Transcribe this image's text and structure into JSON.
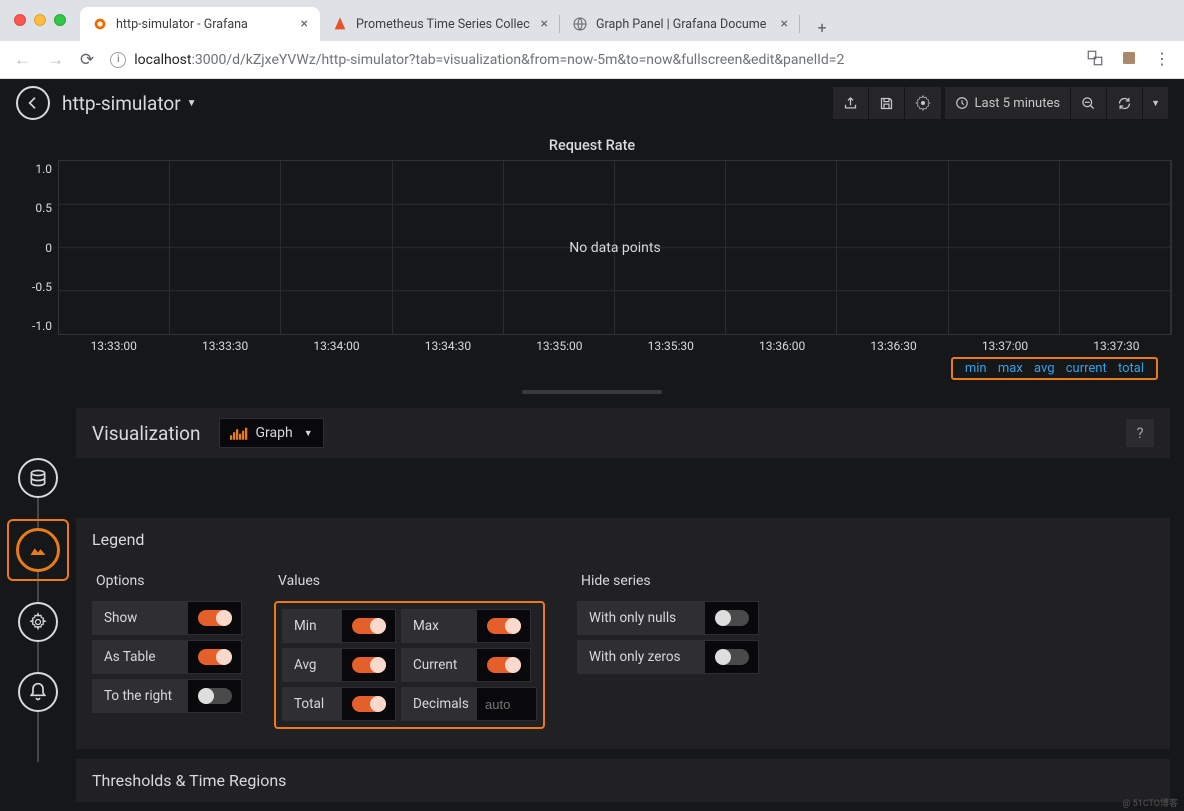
{
  "browser": {
    "tabs": [
      {
        "title": "http-simulator - Grafana",
        "active": true
      },
      {
        "title": "Prometheus Time Series Collec",
        "active": false
      },
      {
        "title": "Graph Panel | Grafana Docume",
        "active": false
      }
    ],
    "url_host": "localhost",
    "url_path": ":3000/d/kZjxeYVWz/http-simulator?tab=visualization&from=now-5m&to=now&fullscreen&edit&panelId=2"
  },
  "header": {
    "dashboard_title": "http-simulator",
    "time_range": "Last 5 minutes"
  },
  "chart_data": {
    "type": "line",
    "title": "Request Rate",
    "no_data_message": "No data points",
    "xlabel": "",
    "ylabel": "",
    "ylim": [
      -1.0,
      1.0
    ],
    "y_ticks": [
      "1.0",
      "0.5",
      "0",
      "-0.5",
      "-1.0"
    ],
    "x_ticks": [
      "13:33:00",
      "13:33:30",
      "13:34:00",
      "13:34:30",
      "13:35:00",
      "13:35:30",
      "13:36:00",
      "13:36:30",
      "13:37:00",
      "13:37:30"
    ],
    "series": [],
    "legend_cols": [
      "min",
      "max",
      "avg",
      "current",
      "total"
    ]
  },
  "editor": {
    "visualization_label": "Visualization",
    "viz_type": "Graph",
    "sections": {
      "legend": {
        "title": "Legend",
        "options_label": "Options",
        "values_label": "Values",
        "hide_label": "Hide series",
        "show": "Show",
        "as_table": "As Table",
        "to_right": "To the right",
        "min": "Min",
        "max": "Max",
        "avg": "Avg",
        "current": "Current",
        "total": "Total",
        "decimals": "Decimals",
        "decimals_placeholder": "auto",
        "only_nulls": "With only nulls",
        "only_zeros": "With only zeros"
      },
      "thresholds": {
        "title": "Thresholds & Time Regions"
      }
    }
  }
}
